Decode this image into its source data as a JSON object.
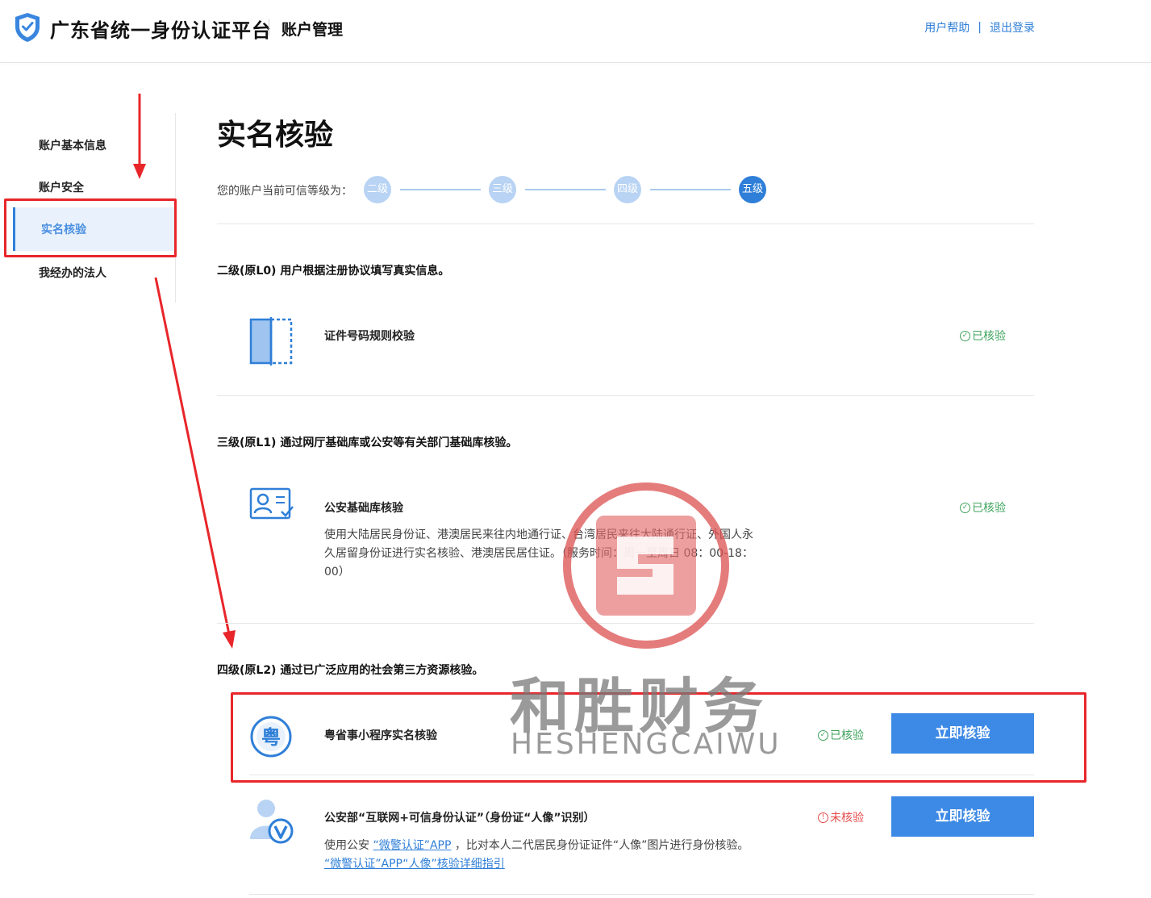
{
  "header": {
    "app_title": "广东省统一身份认证平台",
    "section_title": "账户管理",
    "help_link": "用户帮助",
    "link_separator": "|",
    "logout_link": "退出登录"
  },
  "sidebar": {
    "items": [
      {
        "label": "账户基本信息"
      },
      {
        "label": "账户安全"
      },
      {
        "label": "实名核验",
        "active": true
      },
      {
        "label": "我经办的法人"
      }
    ]
  },
  "main": {
    "title": "实名核验",
    "level_label": "您的账户当前可信等级为：",
    "steps": [
      "二级",
      "三级",
      "四级",
      "五级"
    ],
    "current_step": "五级",
    "levels": [
      {
        "heading": "二级(原L0) 用户根据注册协议填写真实信息。",
        "rows": [
          {
            "icon": "id-card-icon",
            "title": "证件号码规则校验",
            "status": "已核验"
          }
        ]
      },
      {
        "heading": "三级(原L1) 通过网厅基础库或公安等有关部门基础库核验。",
        "rows": [
          {
            "icon": "person-card-icon",
            "title": "公安基础库核验",
            "desc": "使用大陆居民身份证、港澳居民来往内地通行证、台湾居民来往大陆通行证、外国人永久居留身份证进行实名核验、港澳居民居住证。（服务时间：周一至周日 08：00-18：00）",
            "status": "已核验"
          }
        ]
      },
      {
        "heading": "四级(原L2) 通过已广泛应用的社会第三方资源核验。",
        "rows": [
          {
            "icon": "yue-app-icon",
            "title": "粤省事小程序实名核验",
            "status": "已核验",
            "button": "立即核验"
          },
          {
            "icon": "face-verify-icon",
            "title": "公安部“互联网+可信身份认证”（身份证“人像”识别）",
            "desc_prefix": "使用公安",
            "desc_link1": "“微警认证”APP",
            "desc_mid": "，比对本人二代居民身份证证件“人像”图片进行身份核验。",
            "desc_link2": "“微警认证”APP“人像”核验详细指引",
            "status": "未核验",
            "button": "立即核验"
          }
        ]
      }
    ]
  },
  "status_icons": {
    "ok": "✓",
    "warn": "!"
  },
  "watermark": {
    "text": "和胜财务",
    "sub": "HESHENGCAIWU"
  },
  "colors": {
    "accent": "#2f7fd8",
    "ok": "#3fa35c",
    "warn": "#e44b4b",
    "annotation": "#e8262a"
  }
}
